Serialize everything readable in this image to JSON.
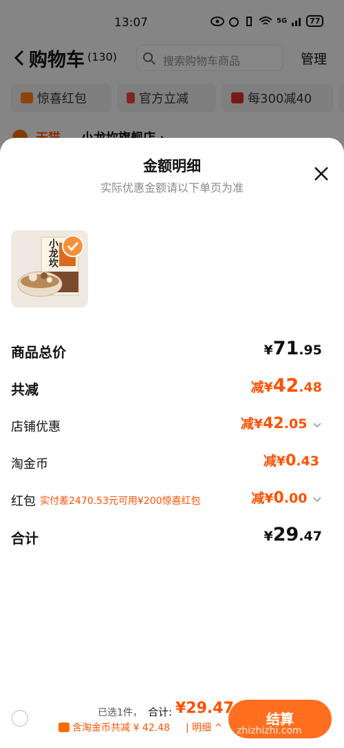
{
  "status_bar": {
    "time": "13:07",
    "network": "5G",
    "battery": "77"
  },
  "header": {
    "title": "购物车",
    "count": "(130)",
    "search_placeholder": "搜索购物车商品",
    "manage": "管理"
  },
  "chips": [
    "惊喜红包",
    "官方立减",
    "每300减40"
  ],
  "store": {
    "brand": "天猫",
    "name": "小龙坎旗舰店 ›"
  },
  "sheet": {
    "title": "金额明细",
    "subtitle": "实际优惠金额请以下单页为准",
    "product": {
      "label": "小龙坎"
    },
    "rows": {
      "total_price": {
        "label": "商品总价",
        "symbol": "¥",
        "int": "71",
        "dec": ".95"
      },
      "total_discount": {
        "label": "共减",
        "prefix": "减¥",
        "int": "42",
        "dec": ".48"
      },
      "store_discount": {
        "label": "店铺优惠",
        "prefix": "减¥",
        "int": "42",
        "dec": ".05"
      },
      "taojinbi": {
        "label": "淘金币",
        "prefix": "减¥",
        "int": "0",
        "dec": ".43"
      },
      "hongbao": {
        "label": "红包",
        "note": "实付差2470.53元可用¥200惊喜红包",
        "prefix": "减¥",
        "int": "0",
        "dec": ".00"
      },
      "grand_total": {
        "label": "合计",
        "symbol": "¥",
        "int": "29",
        "dec": ".47"
      }
    }
  },
  "bottom_bar": {
    "selected": "已选1件，",
    "total_label": "合计:",
    "total_value": "¥29.47",
    "coin_note": "含淘金币共减 ¥ 42.48",
    "detail": "| 明细 ^",
    "checkout": "结算"
  },
  "watermark": "zhizhizhi.com",
  "colors": {
    "accent": "#ff5000",
    "checkout": "#ff6f1f",
    "dark": "#111111"
  }
}
